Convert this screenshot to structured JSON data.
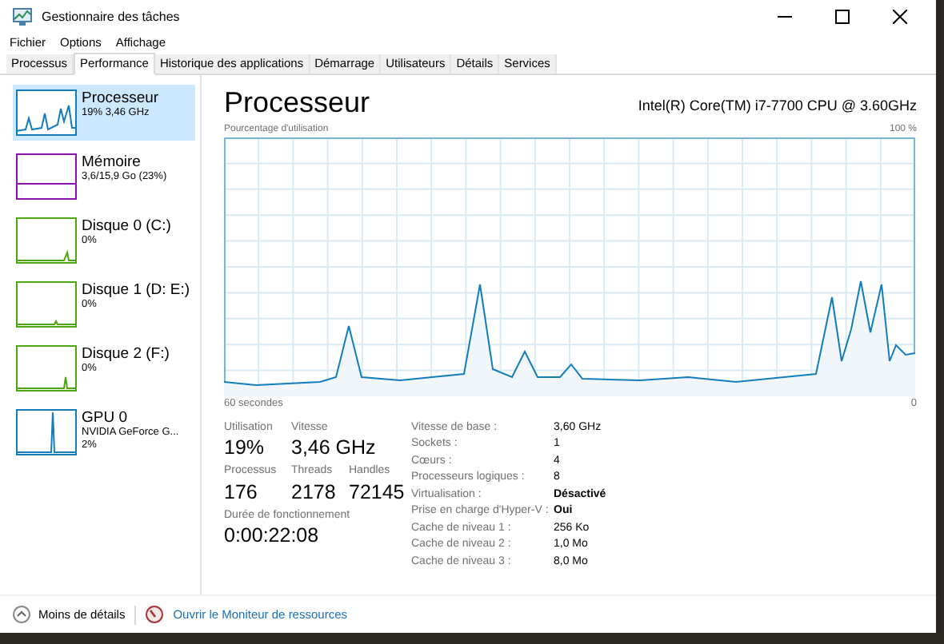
{
  "window": {
    "title": "Gestionnaire des tâches"
  },
  "menu": [
    "Fichier",
    "Options",
    "Affichage"
  ],
  "tabs": [
    {
      "label": "Processus",
      "selected": false
    },
    {
      "label": "Performance",
      "selected": true
    },
    {
      "label": "Historique des applications",
      "selected": false
    },
    {
      "label": "Démarrage",
      "selected": false
    },
    {
      "label": "Utilisateurs",
      "selected": false
    },
    {
      "label": "Détails",
      "selected": false
    },
    {
      "label": "Services",
      "selected": false
    }
  ],
  "sidebar": {
    "items": [
      {
        "name": "Processeur",
        "details": [
          "19% 3,46 GHz"
        ],
        "color": "#117dbb",
        "selected": true
      },
      {
        "name": "Mémoire",
        "details": [
          "3,6/15,9 Go (23%)"
        ],
        "color": "#8b12ae",
        "selected": false
      },
      {
        "name": "Disque 0 (C:)",
        "details": [
          "0%"
        ],
        "color": "#4da60c",
        "selected": false
      },
      {
        "name": "Disque 1 (D: E:)",
        "details": [
          "0%"
        ],
        "color": "#4da60c",
        "selected": false
      },
      {
        "name": "Disque 2 (F:)",
        "details": [
          "0%"
        ],
        "color": "#4da60c",
        "selected": false
      },
      {
        "name": "GPU 0",
        "details": [
          "NVIDIA GeForce G...",
          "2%"
        ],
        "color": "#117dbb",
        "selected": false
      }
    ]
  },
  "main": {
    "title": "Processeur",
    "model": "Intel(R) Core(TM) i7-7700 CPU @ 3.60GHz",
    "graph": {
      "caption": "Pourcentage d'utilisation",
      "max_label": "100 %",
      "start_label": "60 secondes",
      "end_label": "0"
    },
    "stat_rows": [
      [
        {
          "label": "Utilisation",
          "value": "19%"
        },
        {
          "label": "Vitesse",
          "value": "3,46 GHz"
        }
      ],
      [
        {
          "label": "Processus",
          "value": "176"
        },
        {
          "label": "Threads",
          "value": "2178"
        },
        {
          "label": "Handles",
          "value": "72145"
        }
      ],
      [
        {
          "label": "Durée de fonctionnement",
          "value": "0:00:22:08"
        }
      ]
    ],
    "properties": [
      {
        "label": "Vitesse de base :",
        "value": "3,60 GHz",
        "bold": false
      },
      {
        "label": "Sockets :",
        "value": "1",
        "bold": false
      },
      {
        "label": "Cœurs :",
        "value": "4",
        "bold": false
      },
      {
        "label": "Processeurs logiques :",
        "value": "8",
        "bold": false
      },
      {
        "label": "Virtualisation :",
        "value": "Désactivé",
        "bold": true
      },
      {
        "label": "Prise en charge d'Hyper-V :",
        "value": "Oui",
        "bold": true
      },
      {
        "label": "Cache de niveau 1 :",
        "value": "256 Ko",
        "bold": false
      },
      {
        "label": "Cache de niveau 2 :",
        "value": "1,0 Mo",
        "bold": false
      },
      {
        "label": "Cache de niveau 3 :",
        "value": "8,0 Mo",
        "bold": false
      }
    ]
  },
  "footer": {
    "less_details": "Moins de détails",
    "link": "Ouvrir le Moniteur de ressources"
  }
}
